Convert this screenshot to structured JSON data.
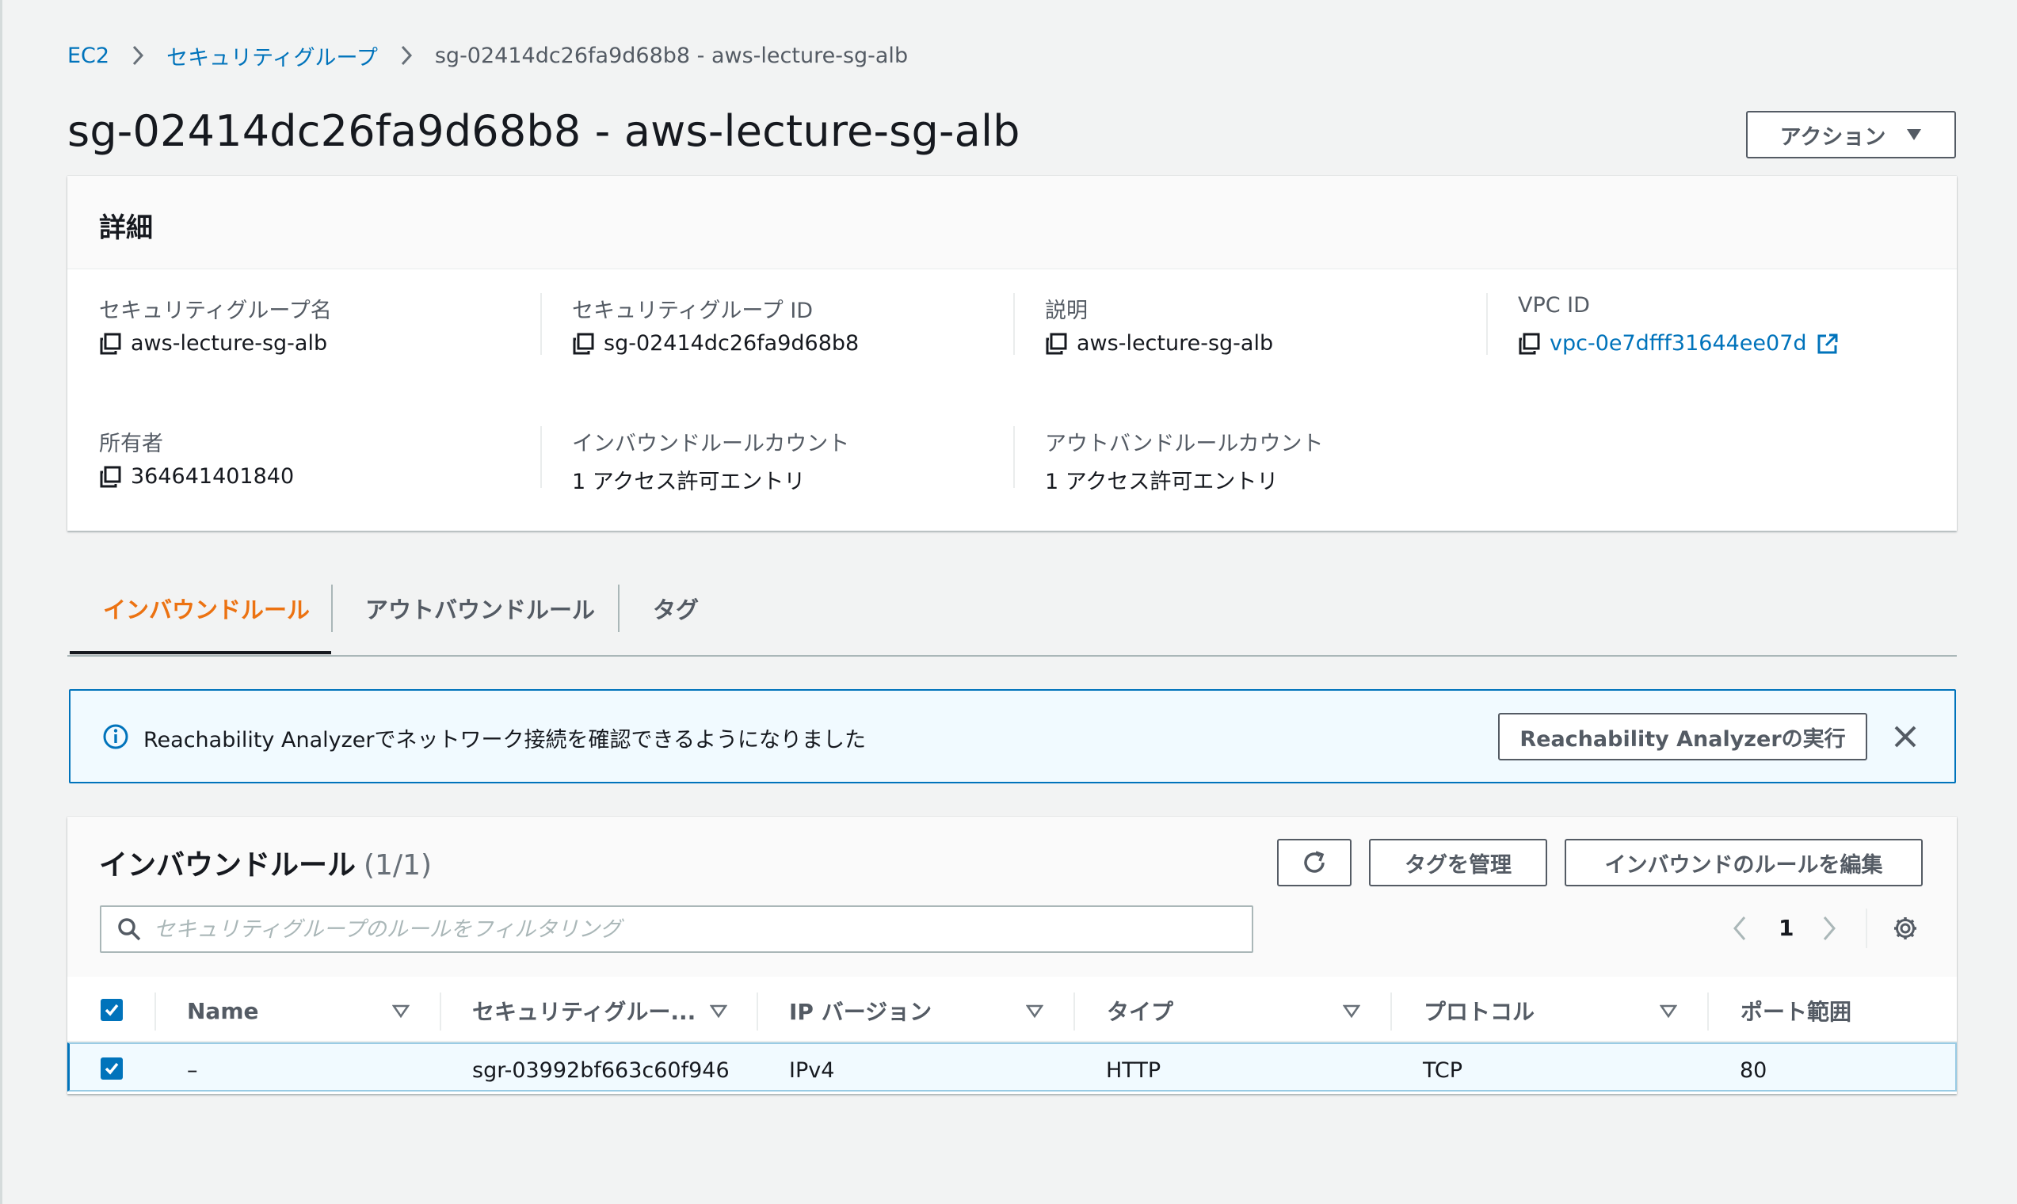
{
  "breadcrumb": {
    "items": [
      "EC2",
      "セキュリティグループ"
    ],
    "current": "sg-02414dc26fa9d68b8 - aws-lecture-sg-alb"
  },
  "page": {
    "title": "sg-02414dc26fa9d68b8 - aws-lecture-sg-alb",
    "actions_label": "アクション"
  },
  "details": {
    "title": "詳細",
    "fields": [
      {
        "label": "セキュリティグループ名",
        "value": "aws-lecture-sg-alb"
      },
      {
        "label": "セキュリティグループ ID",
        "value": "sg-02414dc26fa9d68b8"
      },
      {
        "label": "説明",
        "value": "aws-lecture-sg-alb"
      },
      {
        "label": "VPC ID",
        "value": "vpc-0e7dfff31644ee07d"
      },
      {
        "label": "所有者",
        "value": "364641401840"
      },
      {
        "label": "インバウンドルールカウント",
        "value": "1 アクセス許可エントリ"
      },
      {
        "label": "アウトバンドルールカウント",
        "value": "1 アクセス許可エントリ"
      }
    ]
  },
  "tabs": [
    {
      "label": "インバウンドルール",
      "active": true
    },
    {
      "label": "アウトバウンドルール",
      "active": false
    },
    {
      "label": "タグ",
      "active": false
    }
  ],
  "alert": {
    "text": "Reachability Analyzerでネットワーク接続を確認できるようになりました",
    "button_label": "Reachability Analyzerの実行"
  },
  "rules_table": {
    "title": "インバウンドルール",
    "count": "(1/1)",
    "manage_tags_label": "タグを管理",
    "edit_rules_label": "インバウンドのルールを編集",
    "search_placeholder": "セキュリティグループのルールをフィルタリング",
    "page_number": "1",
    "columns": [
      "Name",
      "セキュリティグルー...",
      "IP バージョン",
      "タイプ",
      "プロトコル",
      "ポート範囲"
    ],
    "rows": [
      {
        "name": "–",
        "rule_id": "sgr-03992bf663c60f946",
        "ip_version": "IPv4",
        "type": "HTTP",
        "protocol": "TCP",
        "port_range": "80"
      }
    ]
  },
  "colors": {
    "link": "#0073bb",
    "active_tab": "#ec7211",
    "info_bg": "#f1faff",
    "selected_row_bg": "#f1faff",
    "page_bg": "#f2f3f3"
  }
}
